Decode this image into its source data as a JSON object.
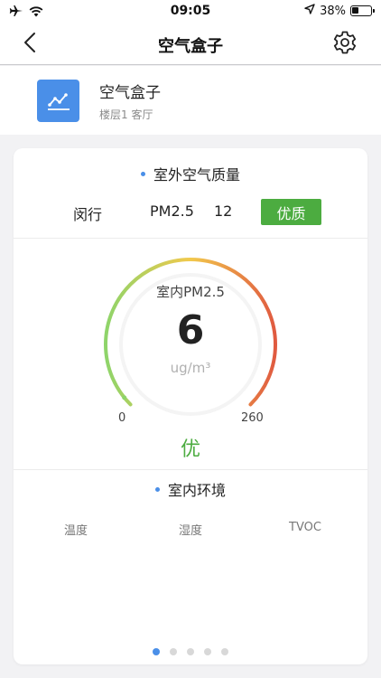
{
  "status_bar": {
    "time": "09:05",
    "battery_text": "38%",
    "battery_level": 0.38
  },
  "nav": {
    "title": "空气盒子"
  },
  "device": {
    "name": "空气盒子",
    "location": "楼层1 客厅"
  },
  "outdoor": {
    "title": "室外空气质量",
    "city": "闵行",
    "pm_label": "PM2.5",
    "pm_value": "12",
    "quality": "优质"
  },
  "indoor_gauge": {
    "label": "室内PM2.5",
    "value": "6",
    "unit": "ug/m³",
    "min": "0",
    "max": "260",
    "grade": "优",
    "numeric_value": 6,
    "range": [
      0,
      260
    ]
  },
  "indoor_env": {
    "title": "室内环境",
    "items": [
      "温度",
      "湿度",
      "TVOC"
    ]
  },
  "pager": {
    "count": 5,
    "active_index": 0
  },
  "colors": {
    "accent": "#4a8fe8",
    "good_green": "#4cac40",
    "gauge_start": "#8ed46a",
    "gauge_mid": "#f2c94c",
    "gauge_end": "#e05a40"
  },
  "icons": {
    "signal": "airplane-icon",
    "wifi": "wifi-icon",
    "location": "location-arrow-icon",
    "battery": "battery-icon",
    "back": "chevron-left-icon",
    "settings": "gear-icon",
    "device": "line-chart-icon"
  }
}
